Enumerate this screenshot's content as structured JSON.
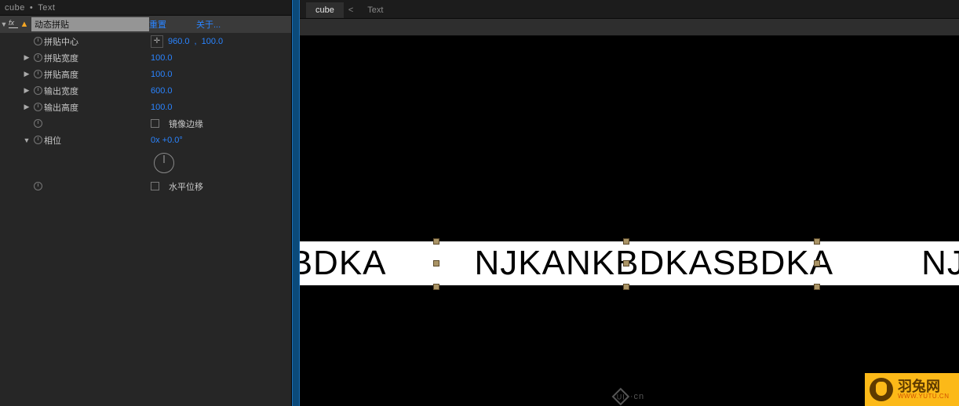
{
  "breadcrumb": {
    "item1": "cube",
    "sep": "•",
    "item2": "Text"
  },
  "effect": {
    "name": "动态拼贴",
    "reset": "重置",
    "about": "关于..."
  },
  "props": {
    "tile_center": {
      "label": "拼贴中心",
      "x": "960.0",
      "y": "100.0"
    },
    "tile_width": {
      "label": "拼贴宽度",
      "value": "100.0"
    },
    "tile_height": {
      "label": "拼贴高度",
      "value": "100.0"
    },
    "out_width": {
      "label": "输出宽度",
      "value": "600.0"
    },
    "out_height": {
      "label": "输出高度",
      "value": "100.0"
    },
    "mirror": {
      "label": "镜像边缘"
    },
    "phase": {
      "label": "相位",
      "value": "0x +0.0°"
    },
    "hshift": {
      "label": "水平位移"
    }
  },
  "tabs": {
    "active": "cube",
    "inactive": "Text",
    "close": "<"
  },
  "canvas": {
    "segment_left": "ASBDKA",
    "segment_center": "NJKANKBDKASBDKA",
    "segment_right": "NJKANK"
  },
  "watermark_center": {
    "symbol": "UI",
    "suffix": "·cn"
  },
  "watermark_corner": {
    "cn": "羽兔网",
    "en": "WWW.YUTU.CN"
  }
}
